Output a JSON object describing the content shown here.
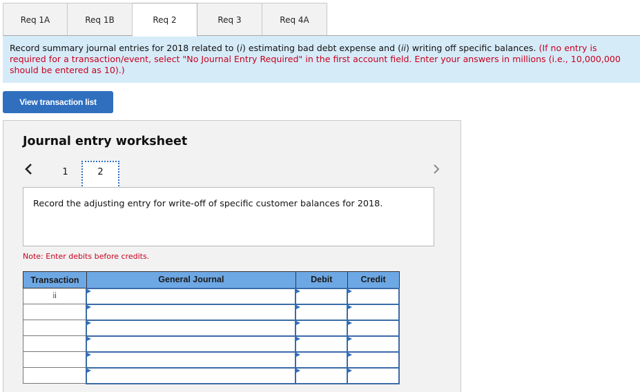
{
  "tabs": [
    {
      "label": "Req 1A",
      "active": false
    },
    {
      "label": "Req 1B",
      "active": false
    },
    {
      "label": "Req 2",
      "active": true
    },
    {
      "label": "Req 3",
      "active": false
    },
    {
      "label": "Req 4A",
      "active": false
    }
  ],
  "instructions": {
    "line_part1": "Record summary journal entries for 2018 related to (",
    "i_label": "i",
    "line_part2": ") estimating bad debt expense and (",
    "ii_label": "ii",
    "line_part3": ") writing off specific balances. ",
    "red_note": "(If no entry is required for a transaction/event, select \"No Journal Entry Required\" in the first account field. Enter your answers in millions (i.e., 10,000,000 should be entered as 10).)"
  },
  "view_transaction_list_label": "View transaction list",
  "worksheet": {
    "title": "Journal entry worksheet",
    "pages": [
      "1",
      "2"
    ],
    "current_page": "2",
    "prev_icon": "chevron-left",
    "next_icon": "chevron-right",
    "description": "Record the adjusting entry for write-off of specific customer balances for 2018.",
    "note": "Note: Enter debits before credits."
  },
  "journal_table": {
    "headers": {
      "transaction": "Transaction",
      "general_journal": "General Journal",
      "debit": "Debit",
      "credit": "Credit"
    },
    "rows": [
      {
        "transaction": "ii",
        "account": "",
        "debit": "",
        "credit": ""
      },
      {
        "transaction": "",
        "account": "",
        "debit": "",
        "credit": ""
      },
      {
        "transaction": "",
        "account": "",
        "debit": "",
        "credit": ""
      },
      {
        "transaction": "",
        "account": "",
        "debit": "",
        "credit": ""
      },
      {
        "transaction": "",
        "account": "",
        "debit": "",
        "credit": ""
      },
      {
        "transaction": "",
        "account": "",
        "debit": "",
        "credit": ""
      }
    ]
  },
  "colors": {
    "accent_blue": "#2f6fbe",
    "banner_bg": "#d6ebf8",
    "instruction_red": "#c8001e",
    "table_header_bg": "#6ea8e4"
  }
}
